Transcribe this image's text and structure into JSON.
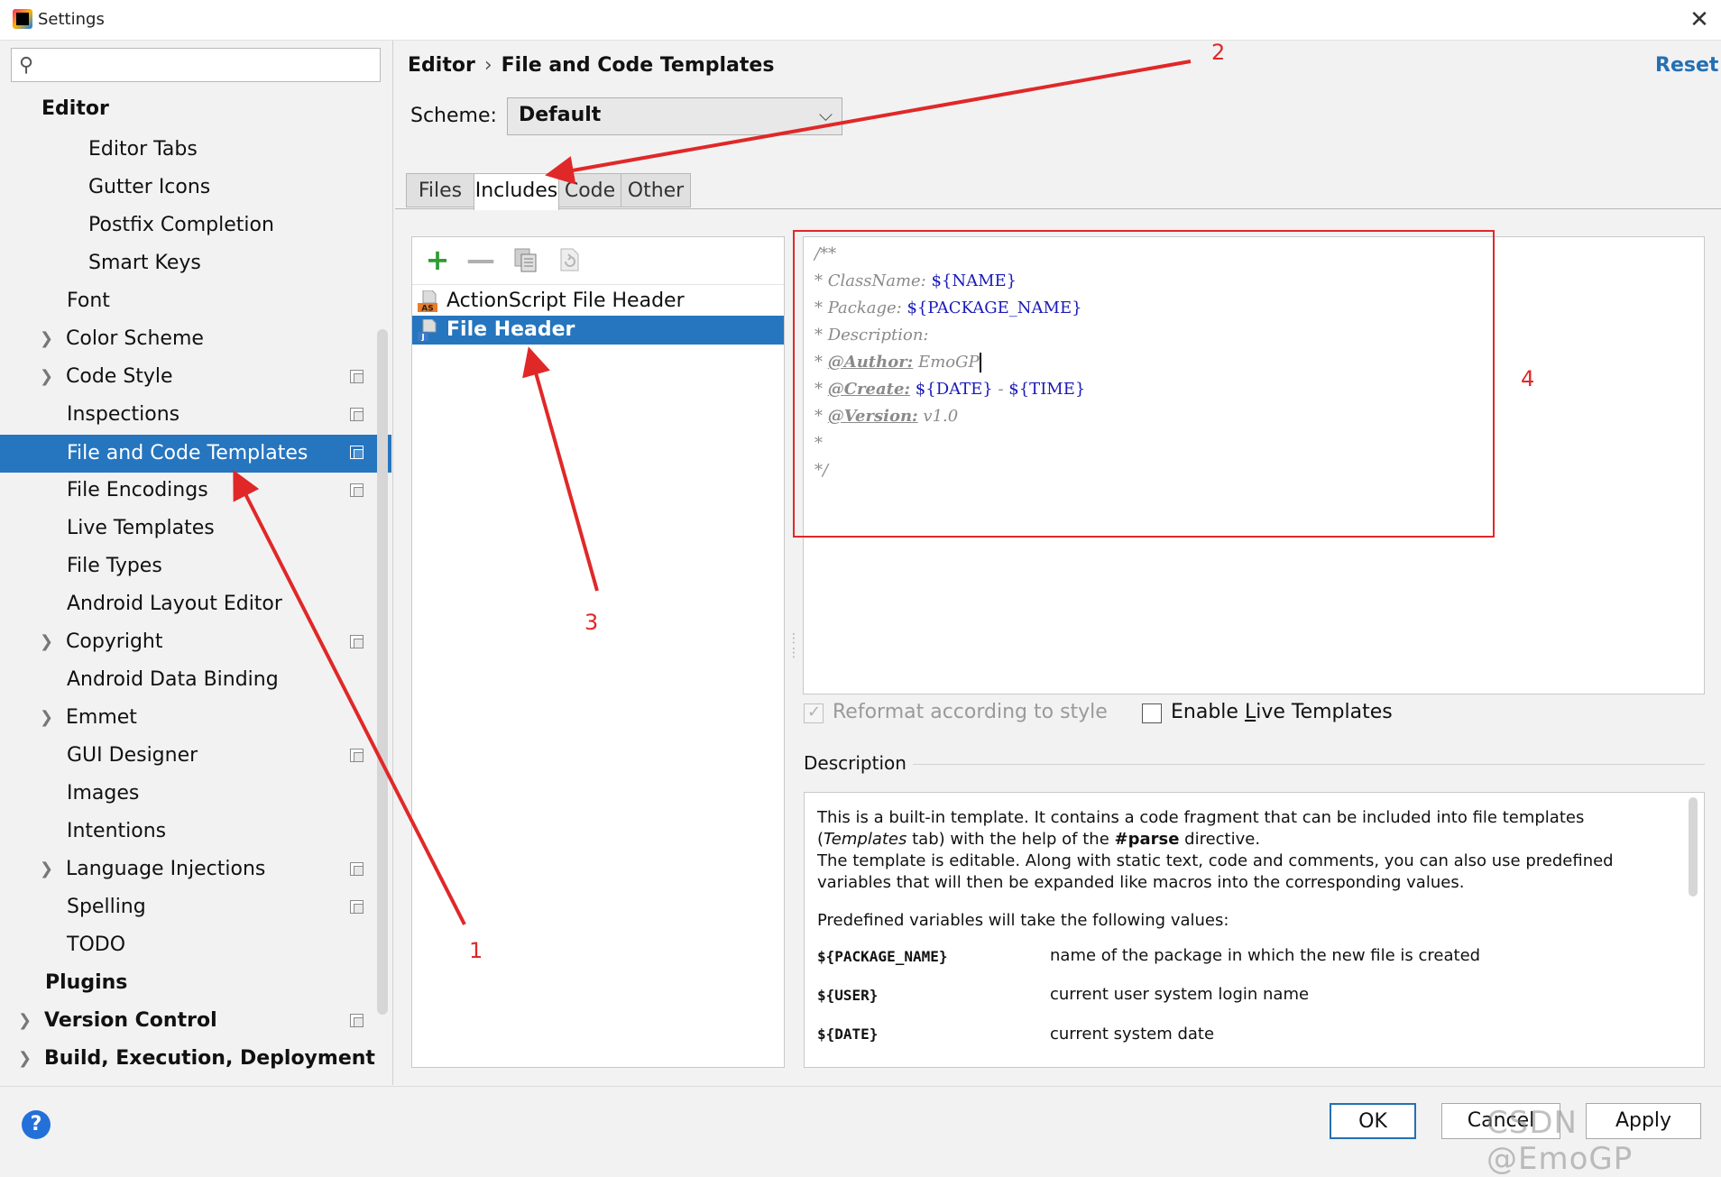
{
  "window": {
    "title": "Settings",
    "close_glyph": "✕"
  },
  "search": {
    "placeholder": ""
  },
  "sidebar": {
    "items": [
      {
        "label": "Editor"
      },
      {
        "label": "Editor Tabs"
      },
      {
        "label": "Gutter Icons"
      },
      {
        "label": "Postfix Completion"
      },
      {
        "label": "Smart Keys"
      },
      {
        "label": "Font"
      },
      {
        "label": "Color Scheme"
      },
      {
        "label": "Code Style"
      },
      {
        "label": "Inspections"
      },
      {
        "label": "File and Code Templates"
      },
      {
        "label": "File Encodings"
      },
      {
        "label": "Live Templates"
      },
      {
        "label": "File Types"
      },
      {
        "label": "Android Layout Editor"
      },
      {
        "label": "Copyright"
      },
      {
        "label": "Android Data Binding"
      },
      {
        "label": "Emmet"
      },
      {
        "label": "GUI Designer"
      },
      {
        "label": "Images"
      },
      {
        "label": "Intentions"
      },
      {
        "label": "Language Injections"
      },
      {
        "label": "Spelling"
      },
      {
        "label": "TODO"
      },
      {
        "label": "Plugins"
      },
      {
        "label": "Version Control"
      },
      {
        "label": "Build, Execution, Deployment"
      }
    ]
  },
  "breadcrumb": {
    "parent": "Editor",
    "separator": "›",
    "current": "File and Code Templates"
  },
  "header": {
    "reset_label": "Reset"
  },
  "scheme": {
    "label": "Scheme:",
    "value": "Default"
  },
  "tabs": [
    {
      "label": "Files"
    },
    {
      "label": "Includes"
    },
    {
      "label": "Code"
    },
    {
      "label": "Other"
    }
  ],
  "toolbar": {
    "add_glyph": "+",
    "remove_glyph": "—"
  },
  "templates": [
    {
      "label": "ActionScript File Header",
      "badge": "AS"
    },
    {
      "label": "File Header",
      "badge": "J"
    }
  ],
  "editor": {
    "lines": {
      "l0": "/**",
      "l1_pre": "* ClassName: ",
      "l1_var": "${NAME}",
      "l2_pre": "* Package: ",
      "l2_var": "${PACKAGE_NAME}",
      "l3": "* Description:",
      "l4_pre": "* ",
      "l4_tag": "@Author:",
      "l4_val": " EmoGP",
      "l5_pre": "* ",
      "l5_tag": "@Create:",
      "l5_var1": " ${DATE}",
      "l5_mid": " - ",
      "l5_var2": "${TIME}",
      "l6_pre": "* ",
      "l6_tag": "@Version:",
      "l6_val": " v1.0",
      "l7": "*",
      "l8": "*/"
    }
  },
  "options": {
    "reformat_label": "Reformat according to style",
    "reformat_checked": true,
    "live_pre": "Enable ",
    "live_u": "L",
    "live_post": "ive Templates",
    "live_checked": false
  },
  "description": {
    "title": "Description",
    "p1_a": "This is a built-in template. It contains a code fragment that can be included into file templates (",
    "p1_b": "Templates",
    "p1_c": " tab) with the help of the ",
    "p1_d": "#parse",
    "p1_e": " directive.",
    "p2": "The template is editable. Along with static text, code and comments, you can also use predefined variables that will then be expanded like macros into the corresponding values.",
    "p3": "Predefined variables will take the following values:",
    "vars": [
      {
        "name": "${PACKAGE_NAME}",
        "desc": "name of the package in which the new file is created"
      },
      {
        "name": "${USER}",
        "desc": "current user system login name"
      },
      {
        "name": "${DATE}",
        "desc": "current system date"
      }
    ]
  },
  "buttons": {
    "help": "?",
    "ok": "OK",
    "cancel": "Cancel",
    "apply": "Apply"
  },
  "watermark": "CSDN @EmoGP",
  "annotations": {
    "n1": "1",
    "n2": "2",
    "n3": "3",
    "n4": "4",
    "color": "#e02828"
  },
  "colors": {
    "accent": "#2675bf",
    "link": "#2470b3",
    "variable": "#1a1ab8",
    "add": "#2e9d35"
  }
}
